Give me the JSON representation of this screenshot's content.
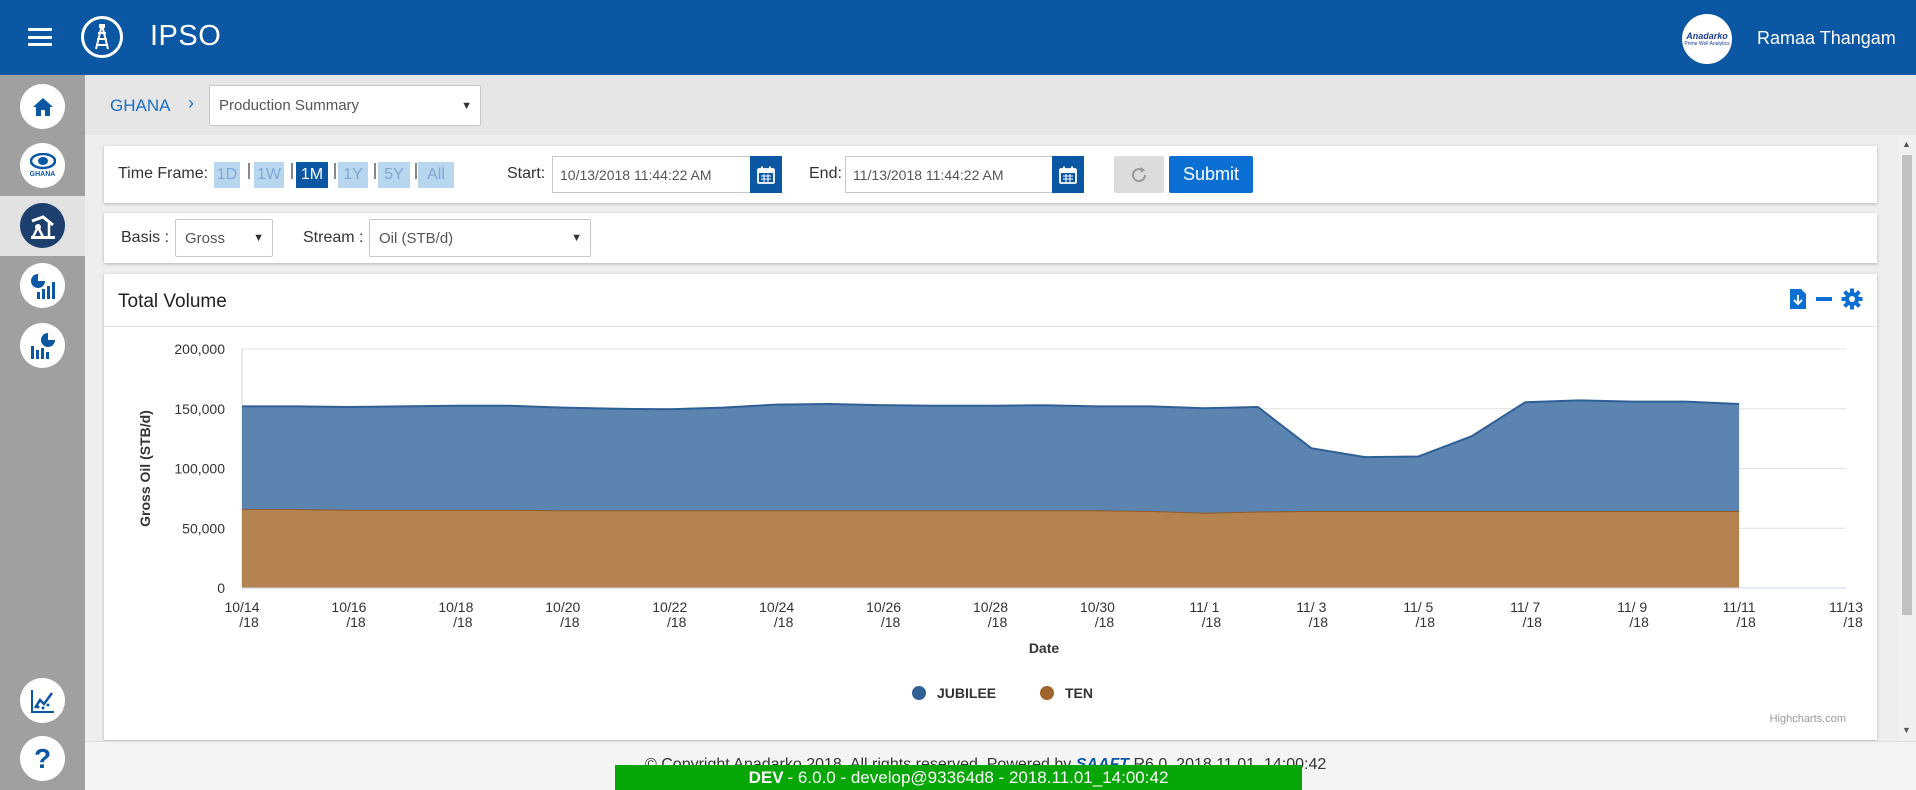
{
  "app": {
    "title": "IPSO",
    "user_name": "Ramaa Thangam",
    "avatar_brand": "Anadarko",
    "avatar_tag": "Prime Well Analytics"
  },
  "sidebar": {
    "items": [
      {
        "name": "home",
        "label": ""
      },
      {
        "name": "ghana",
        "label": "GHANA"
      },
      {
        "name": "production",
        "label": ""
      },
      {
        "name": "analytics",
        "label": ""
      },
      {
        "name": "reports",
        "label": ""
      },
      {
        "name": "trends",
        "label": ""
      },
      {
        "name": "help",
        "label": "?"
      }
    ],
    "active": "production"
  },
  "breadcrumb": {
    "root": "GHANA",
    "separator": "›",
    "selected_view": "Production Summary"
  },
  "filters": {
    "time_frame_label": "Time Frame:",
    "time_frames": [
      "1D",
      "1W",
      "1M",
      "1Y",
      "5Y",
      "All"
    ],
    "active_time_frame": "1M",
    "start_label": "Start:",
    "start_value": "10/13/2018 11:44:22 AM",
    "end_label": "End:",
    "end_value": "11/13/2018 11:44:22 AM",
    "submit_label": "Submit",
    "basis_label": "Basis :",
    "basis_value": "Gross",
    "stream_label": "Stream :",
    "stream_value": "Oil (STB/d)"
  },
  "chart_panel": {
    "title": "Total Volume",
    "credit": "Highcharts.com"
  },
  "chart_data": {
    "type": "area",
    "stacked": true,
    "title": "Total Volume",
    "xlabel": "Date",
    "ylabel": "Gross Oil (STB/d)",
    "ylim": [
      0,
      200000
    ],
    "y_ticks": [
      "0",
      "50,000",
      "100,000",
      "150,000",
      "200,000"
    ],
    "x_ticks": [
      "10/14 /18",
      "10/16 /18",
      "10/18 /18",
      "10/20 /18",
      "10/22 /18",
      "10/24 /18",
      "10/26 /18",
      "10/28 /18",
      "10/30 /18",
      "11/ 1 /18",
      "11/ 3 /18",
      "11/ 5 /18",
      "11/ 7 /18",
      "11/ 9 /18",
      "11/11 /18",
      "11/13 /18"
    ],
    "x": [
      "10/14/18",
      "10/15/18",
      "10/16/18",
      "10/17/18",
      "10/18/18",
      "10/19/18",
      "10/20/18",
      "10/21/18",
      "10/22/18",
      "10/23/18",
      "10/24/18",
      "10/25/18",
      "10/26/18",
      "10/27/18",
      "10/28/18",
      "10/29/18",
      "10/30/18",
      "10/31/18",
      "11/1/18",
      "11/2/18",
      "11/3/18",
      "11/4/18",
      "11/5/18",
      "11/6/18",
      "11/7/18",
      "11/8/18",
      "11/9/18",
      "11/10/18",
      "11/11/18"
    ],
    "x_range": [
      "10/14/18",
      "11/13/18"
    ],
    "legend_position": "bottom-center",
    "grid": true,
    "series": [
      {
        "name": "TEN",
        "color": "#b5834f",
        "values": [
          66000,
          66000,
          65500,
          65500,
          65500,
          65500,
          65000,
          65000,
          65000,
          65000,
          65000,
          65000,
          65000,
          65000,
          65000,
          65000,
          65000,
          64500,
          63000,
          64000,
          64500,
          64500,
          64500,
          64500,
          64500,
          64500,
          64500,
          64500,
          64500
        ]
      },
      {
        "name": "JUBILEE",
        "color": "#5b84b1",
        "values": [
          86000,
          86000,
          86000,
          86500,
          87000,
          87000,
          86000,
          85000,
          84500,
          86000,
          88500,
          89000,
          88000,
          87500,
          87500,
          88000,
          87000,
          87500,
          87500,
          87500,
          52500,
          45000,
          45500,
          62500,
          91000,
          92500,
          91500,
          91500,
          89500
        ]
      }
    ]
  },
  "footer": {
    "copyright": "© Copyright Anadarko 2018. All rights reserved. Powered by",
    "powered_brand": "SAAFT",
    "version": "R6.0_2018.11.01_14:00:42",
    "env": "DEV",
    "build": "- 6.0.0 - develop@93364d8 - 2018.11.01_14:00:42"
  },
  "colors": {
    "header": "#0b57a4",
    "accent": "#0b6fd4",
    "dev_banner": "#06a606"
  }
}
